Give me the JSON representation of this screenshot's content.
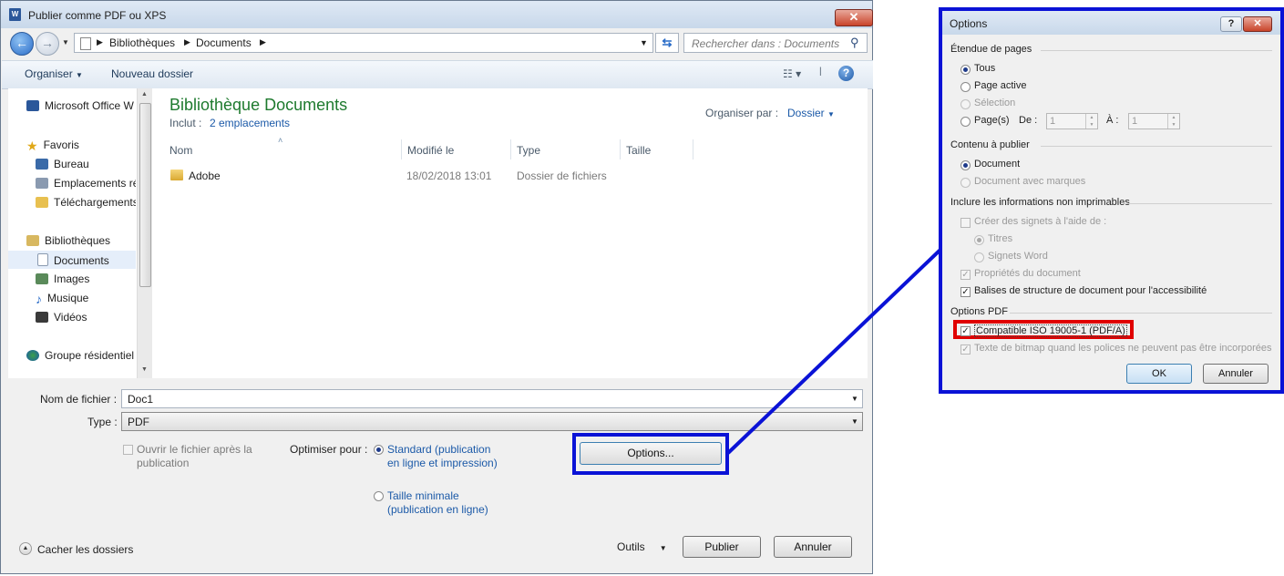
{
  "dialog": {
    "title": "Publier comme PDF ou XPS",
    "close_glyph": "✕",
    "breadcrumb": [
      "Bibliothèques",
      "Documents"
    ],
    "search_placeholder": "Rechercher dans : Documents",
    "toolbar": {
      "organize": "Organiser",
      "new_folder": "Nouveau dossier",
      "help_glyph": "?"
    },
    "nav": {
      "items": [
        {
          "label": "Microsoft Office W",
          "icon": "word-doc-icon"
        },
        {
          "label": "Favoris",
          "icon": "star-icon"
        },
        {
          "label": "Bureau",
          "icon": "desktop-icon"
        },
        {
          "label": "Emplacements ré",
          "icon": "recent-places-icon"
        },
        {
          "label": "Téléchargements",
          "icon": "downloads-icon"
        },
        {
          "label": "Bibliothèques",
          "icon": "libraries-icon"
        },
        {
          "label": "Documents",
          "icon": "documents-icon"
        },
        {
          "label": "Images",
          "icon": "images-icon"
        },
        {
          "label": "Musique",
          "icon": "music-icon"
        },
        {
          "label": "Vidéos",
          "icon": "videos-icon"
        },
        {
          "label": "Groupe résidentiel",
          "icon": "homegroup-icon"
        }
      ]
    },
    "library": {
      "title": "Bibliothèque Documents",
      "includes_label": "Inclut :",
      "includes_link": "2 emplacements",
      "arrange_label": "Organiser par :",
      "arrange_value": "Dossier"
    },
    "columns": [
      "Nom",
      "Modifié le",
      "Type",
      "Taille"
    ],
    "rows": [
      {
        "name": "Adobe",
        "modified": "18/02/2018 13:01",
        "type": "Dossier de fichiers",
        "size": ""
      }
    ],
    "filename_label": "Nom de fichier :",
    "filename_value": "Doc1",
    "type_label": "Type :",
    "type_value": "PDF",
    "open_after_label": "Ouvrir le fichier après la publication",
    "optimize_label": "Optimiser pour :",
    "optimize_standard": "Standard (publication en ligne et impression)",
    "optimize_min": "Taille minimale (publication en ligne)",
    "options_button": "Options...",
    "hide_folders": "Cacher les dossiers",
    "tools": "Outils",
    "publish": "Publier",
    "cancel": "Annuler"
  },
  "options": {
    "title": "Options",
    "help_glyph": "?",
    "close_glyph": "✕",
    "page_range_title": "Étendue de pages",
    "all": "Tous",
    "current_page": "Page active",
    "selection": "Sélection",
    "pages": "Page(s)",
    "from_label": "De :",
    "from_value": "1",
    "to_label": "À :",
    "to_value": "1",
    "publish_what_title": "Contenu à publier",
    "document": "Document",
    "document_markup": "Document avec marques",
    "nonprint_title": "Inclure les informations non imprimables",
    "bookmarks": "Créer des signets à l'aide de :",
    "headings": "Titres",
    "word_bookmarks": "Signets Word",
    "doc_properties": "Propriétés du document",
    "struct_tags": "Balises de structure de document pour l'accessibilité",
    "pdf_options_title": "Options PDF",
    "iso": "Compatible ISO 19005-1 (PDF/A)",
    "bitmap_text": "Texte de bitmap quand les polices ne peuvent pas être incorporées",
    "ok": "OK",
    "cancel": "Annuler"
  },
  "colors": {
    "highlight_blue": "#0a12d6",
    "highlight_red": "#e00000",
    "green_title": "#1e7a2e",
    "link_blue": "#1c5aa8"
  }
}
